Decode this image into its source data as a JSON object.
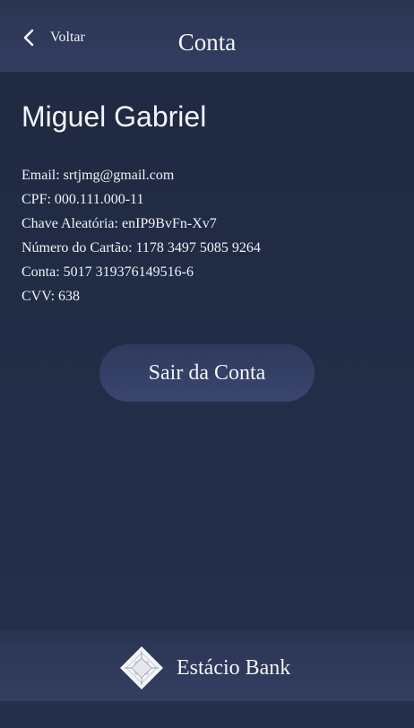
{
  "header": {
    "back_label": "Voltar",
    "title": "Conta"
  },
  "account": {
    "name": "Miguel Gabriel",
    "rows": [
      "Email: srtjmg@gmail.com",
      "CPF: 000.111.000-11",
      "Chave Aleatória: enIP9BvFn-Xv7",
      "Número do Cartão: 1178 3497 5085 9264",
      "Conta: 5017 319376149516-6",
      "CVV: 638"
    ]
  },
  "logout_label": "Sair da Conta",
  "footer": {
    "brand_name": "Estácio Bank",
    "logo_icon": "bank-logo-icon"
  },
  "colors": {
    "background": "#222d47",
    "header": "#2f3a5b",
    "button": "#35416a",
    "text": "#f2f4f8"
  }
}
